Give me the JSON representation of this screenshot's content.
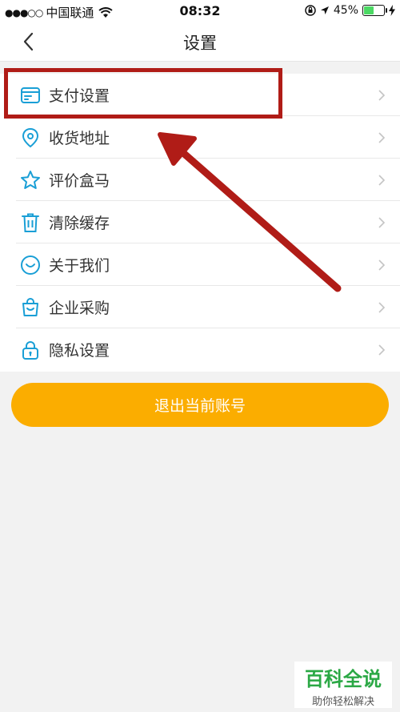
{
  "status_bar": {
    "signal": "●●●○○",
    "carrier": "中国联通",
    "time": "08:32",
    "battery": "45%",
    "battery_level": 0.45
  },
  "header": {
    "title": "设置"
  },
  "menu": {
    "items": [
      {
        "label": "支付设置",
        "icon": "payment-card-icon"
      },
      {
        "label": "收货地址",
        "icon": "location-pin-icon"
      },
      {
        "label": "评价盒马",
        "icon": "star-icon"
      },
      {
        "label": "清除缓存",
        "icon": "trash-icon"
      },
      {
        "label": "关于我们",
        "icon": "smile-icon"
      },
      {
        "label": "企业采购",
        "icon": "shopping-bag-icon"
      },
      {
        "label": "隐私设置",
        "icon": "lock-icon"
      }
    ]
  },
  "logout_button": {
    "label": "退出当前账号"
  },
  "watermark": {
    "title": "百科全说",
    "subtitle": "助你轻松解决"
  },
  "colors": {
    "icon": "#1a9fd6",
    "button": "#fbad00",
    "highlight": "#b01c17",
    "watermark": "#2ba845"
  }
}
